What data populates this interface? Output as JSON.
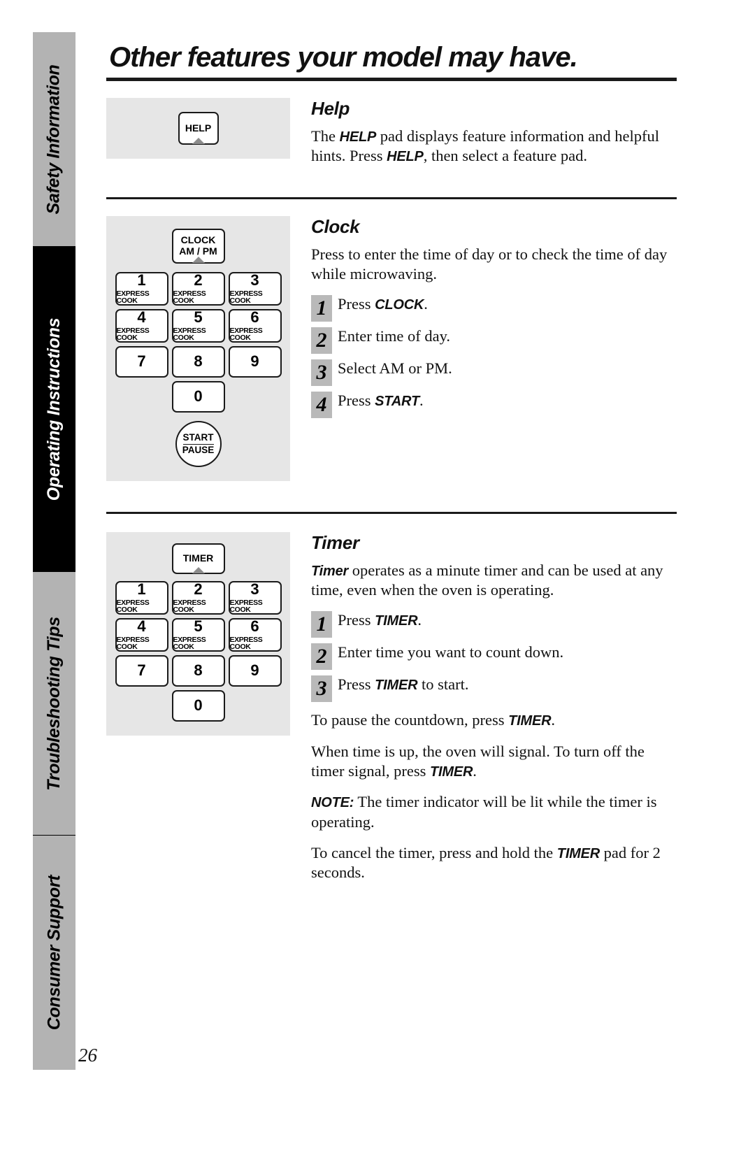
{
  "sidebar": {
    "tabs": [
      {
        "label": "Safety Information",
        "style": "gray"
      },
      {
        "label": "Operating Instructions",
        "style": "black"
      },
      {
        "label": "Troubleshooting Tips",
        "style": "gray"
      },
      {
        "label": "Consumer Support",
        "style": "gray"
      }
    ]
  },
  "page": {
    "title": "Other features your model may have.",
    "number": "26"
  },
  "help_section": {
    "heading": "Help",
    "pad_label": "HELP",
    "body_parts": {
      "p1_a": "The ",
      "p1_b": "HELP",
      "p1_c": " pad displays feature information and helpful hints. Press ",
      "p1_d": "HELP",
      "p1_e": ", then select a feature pad."
    }
  },
  "clock_section": {
    "heading": "Clock",
    "pad_label_line1": "CLOCK",
    "pad_label_line2": "AM / PM",
    "intro": "Press to enter the time of day or to check the time of day while microwaving.",
    "steps": [
      {
        "num": "1",
        "text_a": "Press ",
        "text_b": "CLOCK",
        "text_c": "."
      },
      {
        "num": "2",
        "text_a": "Enter time of day.",
        "text_b": "",
        "text_c": ""
      },
      {
        "num": "3",
        "text_a": "Select AM or PM.",
        "text_b": "",
        "text_c": ""
      },
      {
        "num": "4",
        "text_a": "Press ",
        "text_b": "START",
        "text_c": "."
      }
    ],
    "start_pause": {
      "line1": "START",
      "line2": "PAUSE"
    }
  },
  "timer_section": {
    "heading": "Timer",
    "pad_label": "TIMER",
    "intro_a": "Timer",
    "intro_b": " operates as a minute timer and can be used at any time, even when the oven is operating.",
    "steps": [
      {
        "num": "1",
        "text_a": "Press ",
        "text_b": "TIMER",
        "text_c": "."
      },
      {
        "num": "2",
        "text_a": "Enter time you want to count down.",
        "text_b": "",
        "text_c": ""
      },
      {
        "num": "3",
        "text_a": "Press ",
        "text_b": "TIMER",
        "text_c": " to start."
      }
    ],
    "para_pause_a": "To pause the countdown, press ",
    "para_pause_b": "TIMER",
    "para_pause_c": ".",
    "para_signal_a": "When time is up, the oven will signal. To turn off the timer signal, press ",
    "para_signal_b": "TIMER",
    "para_signal_c": ".",
    "para_note_a": "NOTE:",
    "para_note_b": " The timer indicator will be lit while the timer is operating.",
    "para_cancel_a": "To cancel the timer, press and hold the ",
    "para_cancel_b": "TIMER",
    "para_cancel_c": " pad for 2 seconds."
  },
  "keypad": {
    "keys": [
      {
        "num": "1",
        "sub": "EXPRESS COOK"
      },
      {
        "num": "2",
        "sub": "EXPRESS COOK"
      },
      {
        "num": "3",
        "sub": "EXPRESS COOK"
      },
      {
        "num": "4",
        "sub": "EXPRESS COOK"
      },
      {
        "num": "5",
        "sub": "EXPRESS COOK"
      },
      {
        "num": "6",
        "sub": "EXPRESS COOK"
      },
      {
        "num": "7",
        "sub": ""
      },
      {
        "num": "8",
        "sub": ""
      },
      {
        "num": "9",
        "sub": ""
      }
    ],
    "zero": "0"
  },
  "colors": {
    "tab_gray": "#b3b3b3",
    "tab_black": "#000000",
    "panel_bg": "#e6e6e6",
    "step_badge": "#b9b9b9",
    "rule": "#1a1a1a"
  }
}
